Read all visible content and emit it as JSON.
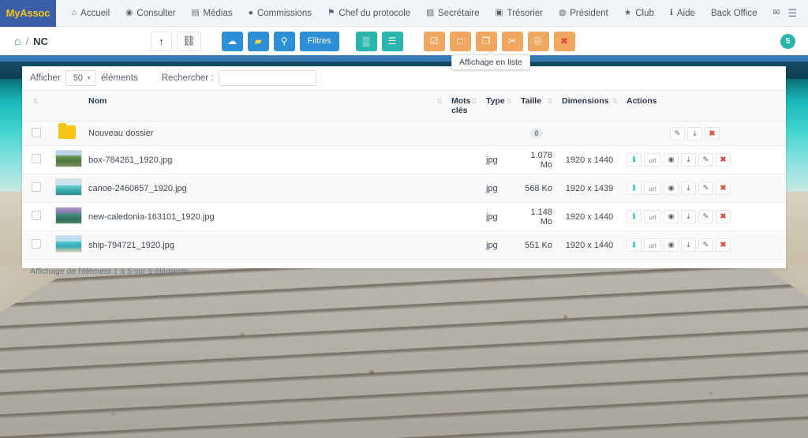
{
  "navbar": {
    "brand": "MyAssoc",
    "items": [
      {
        "label": "Accueil",
        "icon": "home-icon",
        "glyph": "⌂"
      },
      {
        "label": "Consulter",
        "icon": "eye-icon",
        "glyph": "◉"
      },
      {
        "label": "Médias",
        "icon": "file-icon",
        "glyph": "▤"
      },
      {
        "label": "Commissions",
        "icon": "globe-icon",
        "glyph": "●"
      },
      {
        "label": "Chef du protocole",
        "icon": "trophy-icon",
        "glyph": "⚑"
      },
      {
        "label": "Secrétaire",
        "icon": "book-icon",
        "glyph": "▧"
      },
      {
        "label": "Trésorier",
        "icon": "money-icon",
        "glyph": "▣"
      },
      {
        "label": "Président",
        "icon": "globe-icon",
        "glyph": "◍"
      },
      {
        "label": "Club",
        "icon": "star-icon",
        "glyph": "★"
      },
      {
        "label": "Aide",
        "icon": "info-icon",
        "glyph": "ℹ"
      },
      {
        "label": "Back Office",
        "icon": "",
        "glyph": ""
      },
      {
        "label": "",
        "icon": "envelope-icon",
        "glyph": "✉"
      }
    ],
    "burger_icon": "menu-icon",
    "burger_glyph": "☰"
  },
  "toolbar": {
    "breadcrumb": {
      "home_icon": "home-icon",
      "home_glyph": "⌂",
      "separator": "/",
      "current": "NC"
    },
    "buttons": [
      {
        "name": "upload-parent-button",
        "glyph": "↑",
        "style": "plain",
        "label": ""
      },
      {
        "name": "tree-view-button",
        "glyph": "⛓",
        "style": "plain",
        "label": ""
      },
      {
        "name": "cloud-upload-button",
        "glyph": "☁",
        "style": "blue",
        "label": ""
      },
      {
        "name": "new-folder-button",
        "glyph": "▰",
        "style": "blue folder",
        "label": ""
      },
      {
        "name": "search-button",
        "glyph": "⚲",
        "style": "blue",
        "label": ""
      },
      {
        "name": "filters-button",
        "glyph": "",
        "style": "blue filtres",
        "label": "Filtres"
      },
      {
        "name": "grid-view-button",
        "glyph": "▒",
        "style": "teal",
        "label": ""
      },
      {
        "name": "list-view-button",
        "glyph": "☰",
        "style": "teal",
        "label": ""
      },
      {
        "name": "select-all-button",
        "glyph": "☑",
        "style": "orange",
        "label": ""
      },
      {
        "name": "deselect-all-button",
        "glyph": "□",
        "style": "orange",
        "label": ""
      },
      {
        "name": "copy-button",
        "glyph": "❐",
        "style": "orange",
        "label": ""
      },
      {
        "name": "cut-button",
        "glyph": "✂",
        "style": "orange",
        "label": ""
      },
      {
        "name": "paste-button",
        "glyph": "⎘",
        "style": "orange",
        "label": ""
      },
      {
        "name": "delete-button",
        "glyph": "✖",
        "style": "orange x",
        "label": ""
      }
    ],
    "notification_count": "5",
    "tooltip": "Affichage en liste"
  },
  "panel": {
    "length_label": "Afficher",
    "length_value": "50",
    "length_suffix": "éléments",
    "search_label": "Rechercher :",
    "search_value": "",
    "search_placeholder": "",
    "columns": [
      {
        "label": "",
        "sortable": true
      },
      {
        "label": "",
        "sortable": false
      },
      {
        "label": "Nom",
        "sortable": true
      },
      {
        "label": "Mots clés",
        "sortable": true
      },
      {
        "label": "Type",
        "sortable": true
      },
      {
        "label": "Taille",
        "sortable": true
      },
      {
        "label": "Dimensions",
        "sortable": true
      },
      {
        "label": "Actions",
        "sortable": false
      }
    ],
    "rows": [
      {
        "kind": "folder",
        "name": "Nouveau dossier",
        "keywords": "",
        "type": "",
        "size": "0",
        "dimensions": "",
        "actions": [
          "edit",
          "download",
          "delete"
        ]
      },
      {
        "kind": "image",
        "thumb": "th1",
        "name": "box-784261_1920.jpg",
        "keywords": "",
        "type": "jpg",
        "size": "1.078 Mo",
        "dimensions": "1920 x 1440",
        "actions": [
          "info",
          "url",
          "preview",
          "download",
          "edit",
          "delete"
        ]
      },
      {
        "kind": "image",
        "thumb": "th2",
        "name": "canoe-2460657_1920.jpg",
        "keywords": "",
        "type": "jpg",
        "size": "568 Ko",
        "dimensions": "1920 x 1439",
        "actions": [
          "info",
          "url",
          "preview",
          "download",
          "edit",
          "delete"
        ]
      },
      {
        "kind": "image",
        "thumb": "th3",
        "name": "new-caledonia-163101_1920.jpg",
        "keywords": "",
        "type": "jpg",
        "size": "1.148 Mo",
        "dimensions": "1920 x 1440",
        "actions": [
          "info",
          "url",
          "preview",
          "download",
          "edit",
          "delete"
        ]
      },
      {
        "kind": "image",
        "thumb": "th4",
        "name": "ship-794721_1920.jpg",
        "keywords": "",
        "type": "jpg",
        "size": "551 Ko",
        "dimensions": "1920 x 1440",
        "actions": [
          "info",
          "url",
          "preview",
          "download",
          "edit",
          "delete"
        ]
      }
    ],
    "footer": "Affichage de l'élément 1 à 5 sur 5 éléments"
  },
  "action_glyphs": {
    "info": "ℹ",
    "url": "url",
    "preview": "◉",
    "download": "⤓",
    "edit": "✎",
    "delete": "✖"
  },
  "colors": {
    "brand_blue": "#3b5ea8",
    "brand_yellow": "#f5c518",
    "accent_blue": "#2d8fd5",
    "accent_teal": "#2ab5ad",
    "accent_orange": "#f0a860",
    "danger_red": "#e8453c",
    "strip_blue": "#3679b5"
  }
}
